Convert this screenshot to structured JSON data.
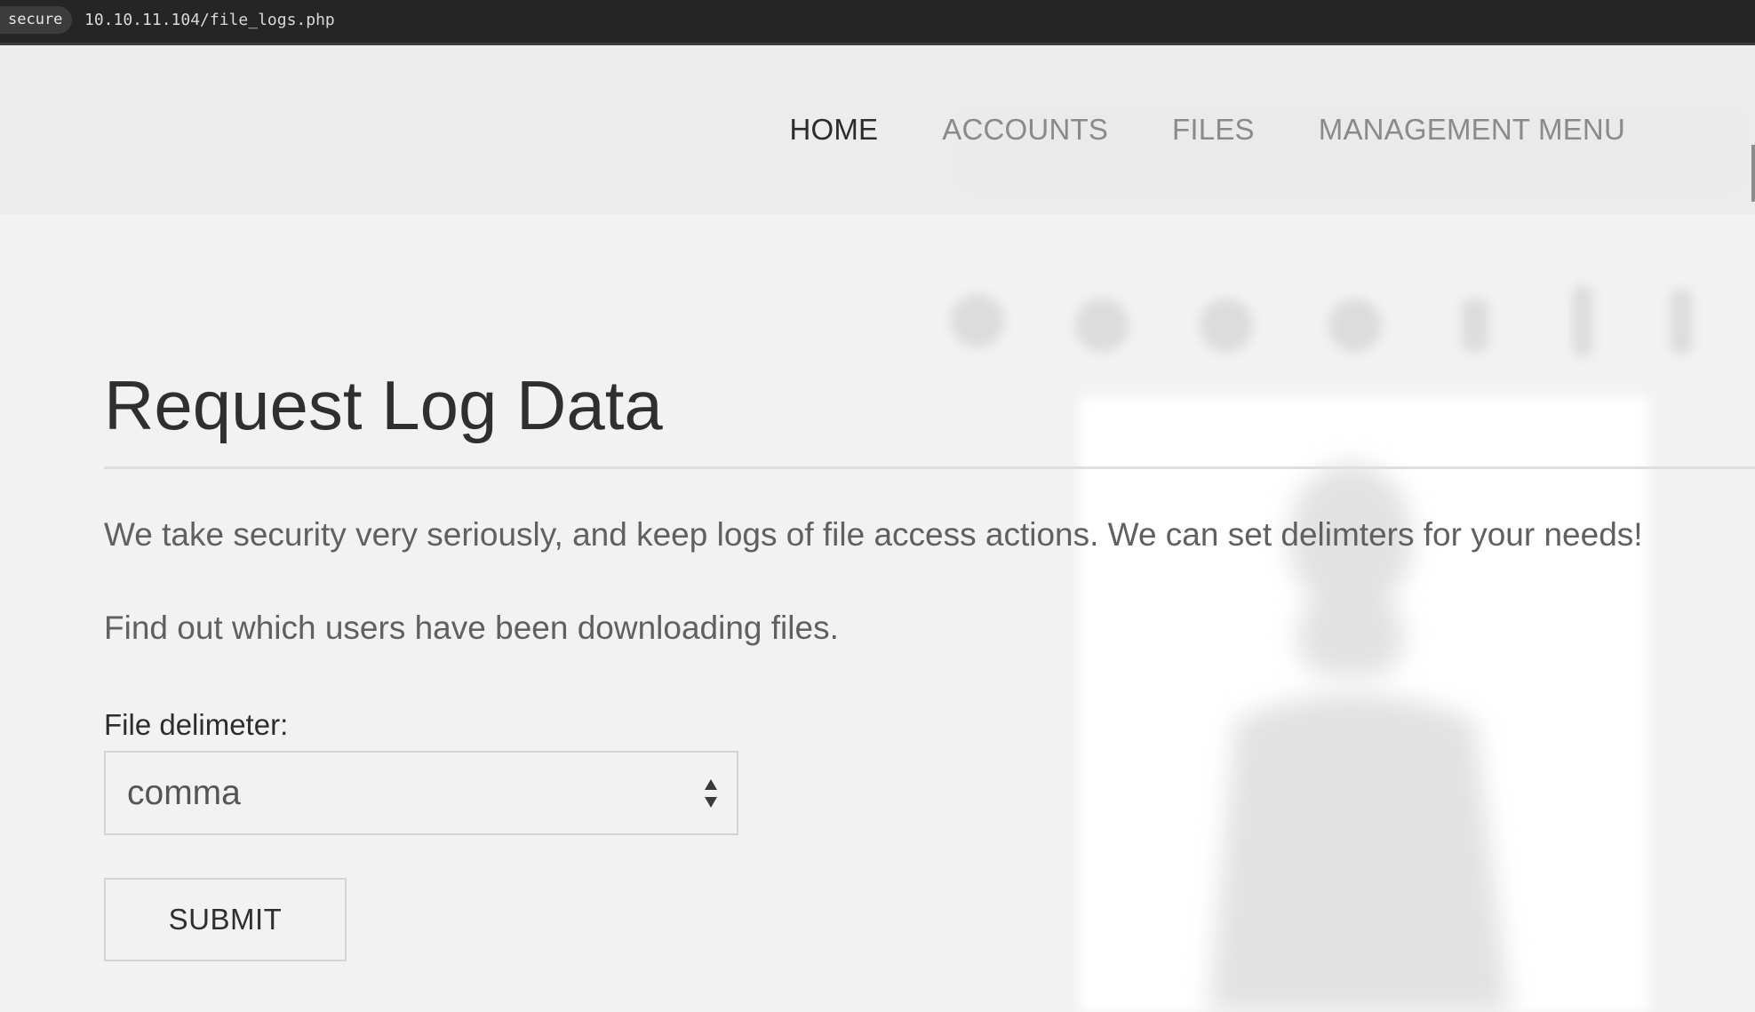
{
  "browser": {
    "secure_label": "secure",
    "url": "10.10.11.104/file_logs.php"
  },
  "nav": {
    "items": [
      {
        "label": "HOME",
        "active": true
      },
      {
        "label": "ACCOUNTS",
        "active": false
      },
      {
        "label": "FILES",
        "active": false
      },
      {
        "label": "MANAGEMENT MENU",
        "active": false
      }
    ]
  },
  "main": {
    "title": "Request Log Data",
    "paragraph_1": "We take security very seriously, and keep logs of file access actions. We can set delimters for your needs!",
    "paragraph_2": "Find out which users have been downloading files.",
    "delimiter_label": "File delimeter:",
    "delimiter_value": "comma",
    "submit_label": "SUBMIT"
  },
  "colors": {
    "background": "#f2f2f2",
    "header": "#eaeaea",
    "nav_active": "#2b2b2b",
    "nav_inactive": "#8a8a8a",
    "title": "#2f2f2f",
    "body_text": "#606060"
  }
}
